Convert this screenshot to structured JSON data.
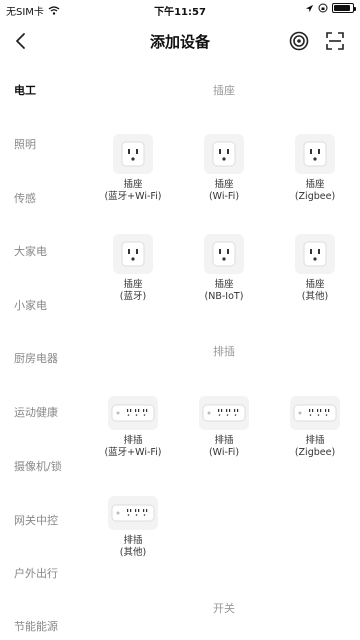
{
  "status_bar": {
    "carrier": "无SIM卡",
    "time": "下午11:57",
    "battery_level": 0.9
  },
  "nav": {
    "title": "添加设备",
    "back_icon": "chevron-left-icon",
    "wifi_icon": "wifi-signal-icon",
    "scan_icon": "scan-frame-icon"
  },
  "sidebar": {
    "items": [
      {
        "label": "电工",
        "active": true
      },
      {
        "label": "照明",
        "active": false
      },
      {
        "label": "传感",
        "active": false
      },
      {
        "label": "大家电",
        "active": false
      },
      {
        "label": "小家电",
        "active": false
      },
      {
        "label": "厨房电器",
        "active": false
      },
      {
        "label": "运动健康",
        "active": false
      },
      {
        "label": "摄像机/锁",
        "active": false
      },
      {
        "label": "网关中控",
        "active": false
      },
      {
        "label": "户外出行",
        "active": false
      },
      {
        "label": "节能能源",
        "active": false
      }
    ]
  },
  "sections": {
    "socket": {
      "title": "插座",
      "devices": [
        {
          "name": "插座",
          "sub": "(蓝牙+Wi-Fi)"
        },
        {
          "name": "插座",
          "sub": "(Wi-Fi)"
        },
        {
          "name": "插座",
          "sub": "(Zigbee)"
        },
        {
          "name": "插座",
          "sub": "(蓝牙)"
        },
        {
          "name": "插座",
          "sub": "(NB-IoT)"
        },
        {
          "name": "插座",
          "sub": "(其他)"
        }
      ]
    },
    "strip": {
      "title": "排插",
      "devices": [
        {
          "name": "排插",
          "sub": "(蓝牙+Wi-Fi)"
        },
        {
          "name": "排插",
          "sub": "(Wi-Fi)"
        },
        {
          "name": "排插",
          "sub": "(Zigbee)"
        },
        {
          "name": "排插",
          "sub": "(其他)"
        }
      ]
    },
    "switch": {
      "title": "开关"
    }
  }
}
